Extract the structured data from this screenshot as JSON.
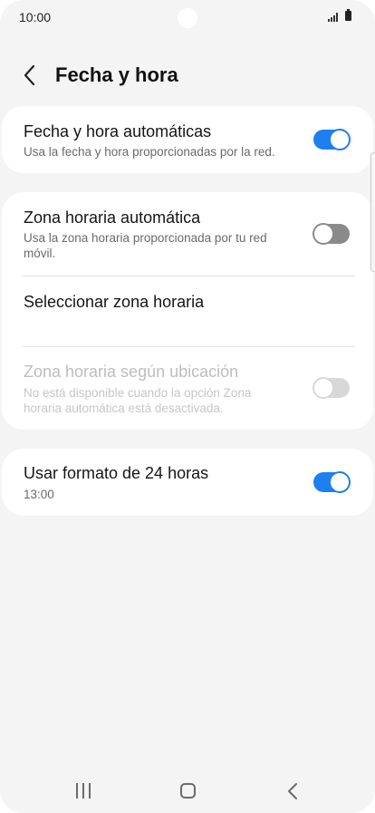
{
  "status_bar": {
    "time": "10:00",
    "signal_icon": "signal-icon",
    "battery_icon": "battery-icon"
  },
  "header": {
    "title": "Fecha y hora",
    "back_icon": "chevron-left-icon"
  },
  "card1": {
    "auto_datetime": {
      "title": "Fecha y hora automáticas",
      "subtitle": "Usa la fecha y hora proporcionadas por la red.",
      "toggle": "on"
    }
  },
  "card2": {
    "auto_timezone": {
      "title": "Zona horaria automática",
      "subtitle": "Usa la zona horaria proporcionada por tu red móvil.",
      "toggle": "off"
    },
    "select_timezone": {
      "title": "Seleccionar zona horaria"
    },
    "location_timezone": {
      "title": "Zona horaria según ubicación",
      "subtitle": "No está disponible cuando la opción Zona horaria automática está desactivada.",
      "toggle": "off",
      "disabled": true
    }
  },
  "card3": {
    "format_24h": {
      "title": "Usar formato de 24 horas",
      "subtitle": "13:00",
      "toggle": "on"
    }
  },
  "nav_bar": {
    "recent_icon": "recent-apps-icon",
    "home_icon": "home-icon",
    "back_icon": "back-icon"
  },
  "colors": {
    "accent": "#1e7ff0",
    "background": "#f4f4f4",
    "card": "#ffffff"
  }
}
